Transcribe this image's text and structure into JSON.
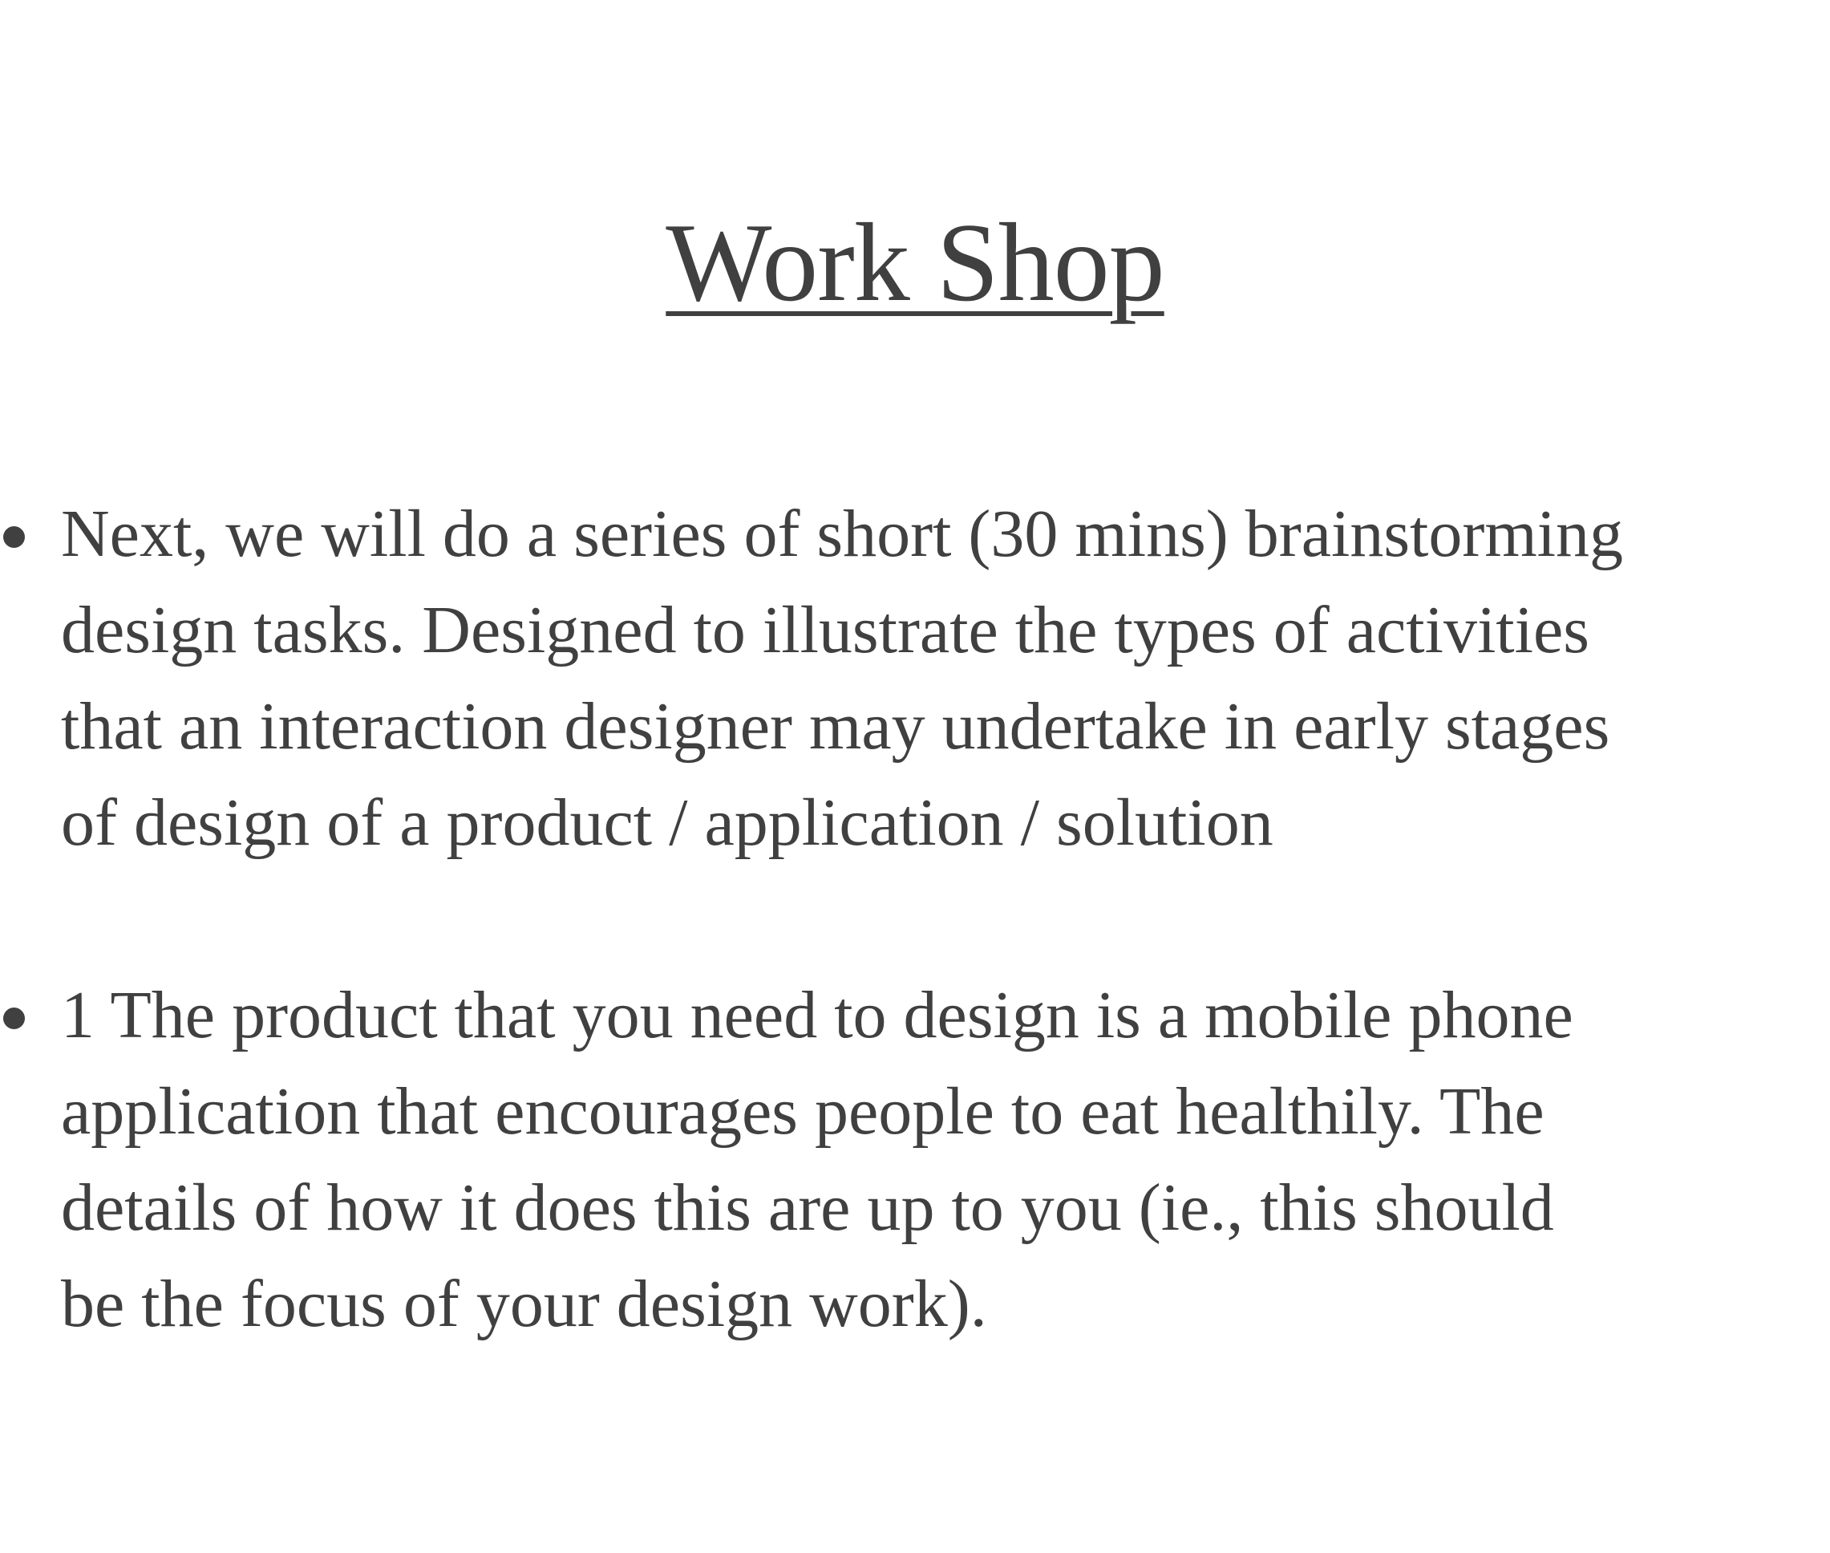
{
  "slide": {
    "title": "Work Shop",
    "bullets": [
      {
        "lines": [
          "Next, we will do a series of short (30 mins) brainstorming",
          "design tasks. Designed to illustrate the types of activities",
          "that an interaction designer may undertake in early stages",
          "of design of a product / application / solution"
        ]
      },
      {
        "lines": [
          "1 The product that you need to design is a mobile phone",
          "application that encourages people to eat healthily. The",
          "details of how it does this are up to you (ie., this should",
          "be the focus of your design work)."
        ]
      }
    ]
  },
  "colors": {
    "text": "#404040",
    "background": "#ffffff"
  }
}
